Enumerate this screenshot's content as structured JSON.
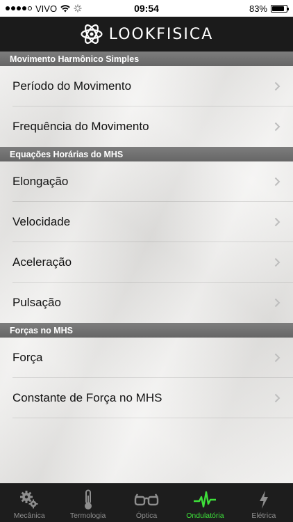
{
  "status_bar": {
    "carrier": "VIVO",
    "time": "09:54",
    "battery": "83%",
    "battery_level": 0.83,
    "signal_bars": 4
  },
  "header": {
    "title": "LOOKFISICA"
  },
  "sections": [
    {
      "title": "Movimento Harmônico Simples",
      "items": [
        "Período do Movimento",
        "Frequência do Movimento"
      ]
    },
    {
      "title": "Equações Horárias do MHS",
      "items": [
        "Elongação",
        "Velocidade",
        "Aceleração",
        "Pulsação"
      ]
    },
    {
      "title": "Forças no MHS",
      "items": [
        "Força",
        "Constante de Força no MHS"
      ]
    }
  ],
  "tabs": [
    {
      "label": "Mecânica",
      "icon": "gears-icon",
      "active": false
    },
    {
      "label": "Termologia",
      "icon": "thermometer-icon",
      "active": false
    },
    {
      "label": "Óptica",
      "icon": "glasses-icon",
      "active": false
    },
    {
      "label": "Ondulatória",
      "icon": "wave-pulse-icon",
      "active": true
    },
    {
      "label": "Elétrica",
      "icon": "lightning-icon",
      "active": false
    }
  ],
  "colors": {
    "header_bg": "#1b1b1b",
    "section_bg": "#707070",
    "tab_active": "#3ee03a",
    "tab_inactive": "#8e8e8e"
  }
}
